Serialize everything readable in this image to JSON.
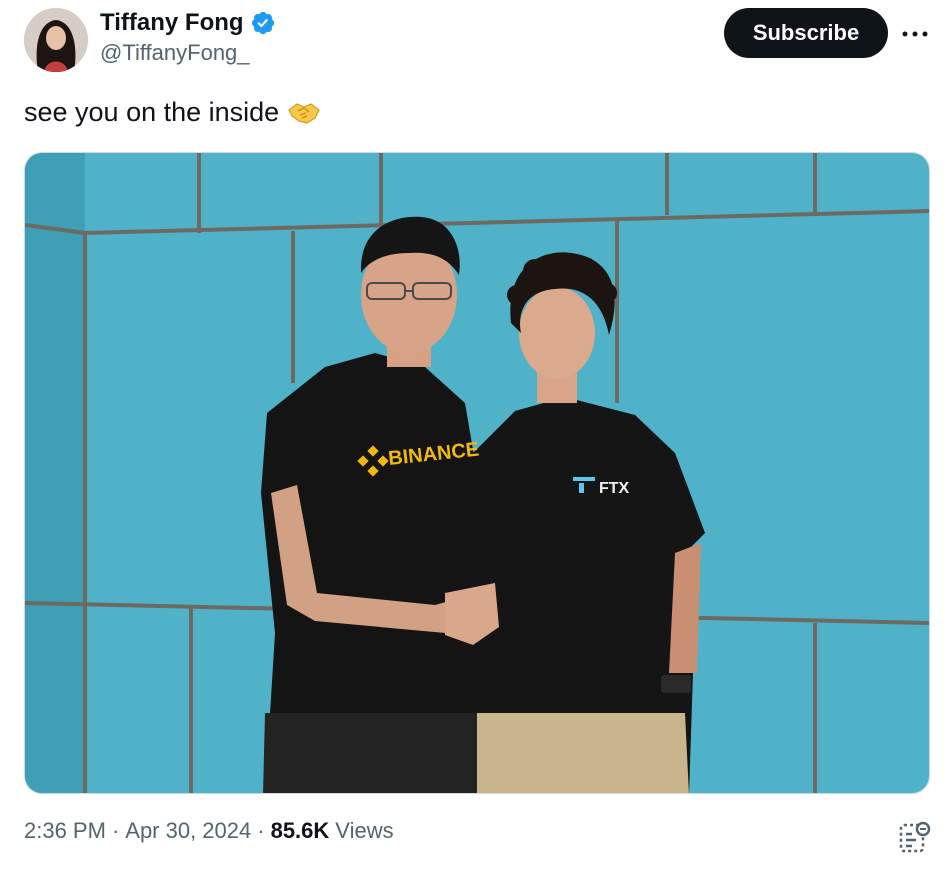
{
  "author": {
    "name": "Tiffany Fong",
    "handle": "@TiffanyFong_",
    "verified_color": "#1d9bf0"
  },
  "actions": {
    "subscribe_label": "Subscribe",
    "more_icon": "more-dots-icon"
  },
  "tweet": {
    "text": "see you on the inside",
    "emoji": "handshake-emoji"
  },
  "photo": {
    "left_shirt_text": "BINANCE",
    "right_shirt_text": "FTX"
  },
  "meta": {
    "time": "2:36 PM",
    "separator": "·",
    "date": "Apr 30, 2024",
    "views_count": "85.6K",
    "views_label": "Views"
  },
  "colors": {
    "accent_dark": "#0f1419",
    "secondary_text": "#536471",
    "wall_teal": "#4fb3c9"
  }
}
